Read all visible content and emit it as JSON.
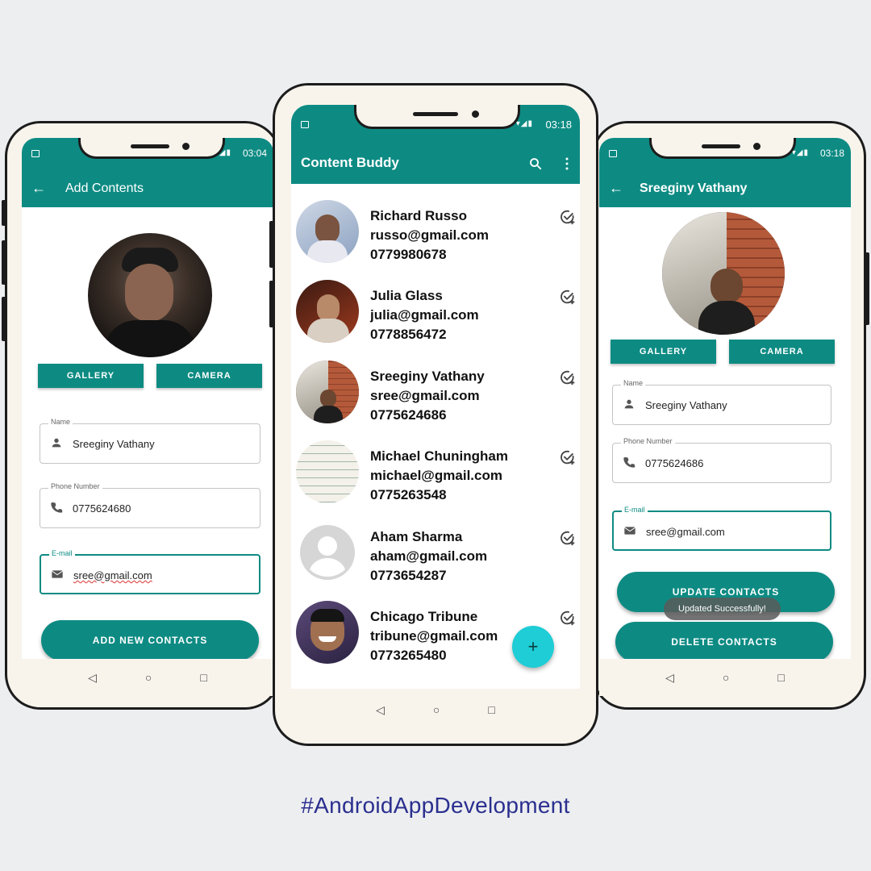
{
  "colors": {
    "accent": "#0d8b83",
    "fab": "#1ecdd6",
    "hashtag": "#2a2f8f"
  },
  "left_phone": {
    "status_time": "03:04",
    "title": "Add Contents",
    "gallery_label": "GALLERY",
    "camera_label": "CAMERA",
    "name_label": "Name",
    "name_value": "Sreeginy Vathany",
    "phone_label": "Phone Number",
    "phone_value": "0775624680",
    "email_label": "E-mail",
    "email_value": "sree@gmail.com",
    "add_button": "ADD NEW CONTACTS"
  },
  "center_phone": {
    "status_time": "03:18",
    "title": "Content Buddy",
    "contacts": [
      {
        "name": "Richard Russo",
        "email": "russo@gmail.com",
        "phone": "0779980678"
      },
      {
        "name": "Julia Glass",
        "email": "julia@gmail.com",
        "phone": "0778856472"
      },
      {
        "name": "Sreeginy Vathany",
        "email": "sree@gmail.com",
        "phone": "0775624686"
      },
      {
        "name": "Michael Chuningham",
        "email": "michael@gmail.com",
        "phone": "0775263548"
      },
      {
        "name": "Aham Sharma",
        "email": "aham@gmail.com",
        "phone": "0773654287"
      },
      {
        "name": "Chicago Tribune",
        "email": "tribune@gmail.com",
        "phone": "0773265480"
      }
    ],
    "fab_label": "+"
  },
  "right_phone": {
    "status_time": "03:18",
    "title": "Sreeginy Vathany",
    "gallery_label": "GALLERY",
    "camera_label": "CAMERA",
    "name_label": "Name",
    "name_value": "Sreeginy Vathany",
    "phone_label": "Phone Number",
    "phone_value": "0775624686",
    "email_label": "E-mail",
    "email_value": "sree@gmail.com",
    "update_button": "UPDATE CONTACTS",
    "toast": "Updated Successfully!",
    "delete_button": "DELETE CONTACTS"
  },
  "hashtag": "#AndroidAppDevelopment"
}
